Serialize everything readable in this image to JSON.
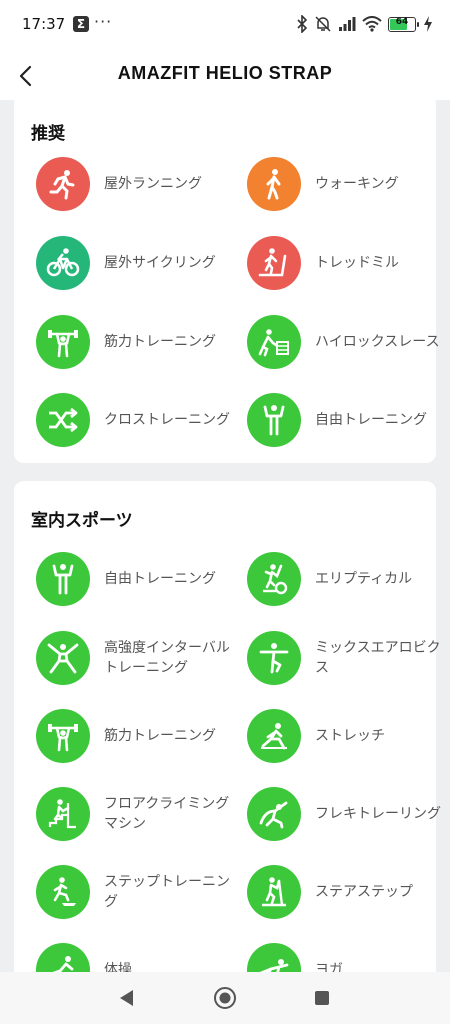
{
  "status_bar": {
    "time": "17:37",
    "notification_icon": "sigma-icon",
    "more": "···",
    "battery_level": "64",
    "icons": [
      "bluetooth-icon",
      "bell-off-icon",
      "signal-icon",
      "wifi-icon",
      "battery-icon",
      "charging-icon"
    ]
  },
  "header": {
    "title": "AMAZFIT HELIO STRAP",
    "back_icon": "back-chevron-icon"
  },
  "colors": {
    "red": "#ea5b53",
    "orange": "#f28130",
    "teal": "#25b77a",
    "green": "#3cc83a"
  },
  "sections": [
    {
      "title": "推奨",
      "items": [
        {
          "label": "屋外ランニング",
          "icon": "running-icon",
          "color": "#ea5b53"
        },
        {
          "label": "ウォーキング",
          "icon": "walking-icon",
          "color": "#f28130"
        },
        {
          "label": "屋外サイクリング",
          "icon": "cycling-icon",
          "color": "#25b77a"
        },
        {
          "label": "トレッドミル",
          "icon": "treadmill-icon",
          "color": "#ea5b53"
        },
        {
          "label": "筋力トレーニング",
          "icon": "weightlifting-icon",
          "color": "#3cc83a"
        },
        {
          "label": "ハイロックスレース",
          "icon": "hyrox-icon",
          "color": "#3cc83a"
        },
        {
          "label": "クロストレーニング",
          "icon": "shuffle-icon",
          "color": "#3cc83a"
        },
        {
          "label": "自由トレーニング",
          "icon": "free-training-icon",
          "color": "#3cc83a"
        }
      ]
    },
    {
      "title": "室内スポーツ",
      "items": [
        {
          "label": "自由トレーニング",
          "icon": "free-training-icon",
          "color": "#3cc83a"
        },
        {
          "label": "エリプティカル",
          "icon": "elliptical-icon",
          "color": "#3cc83a"
        },
        {
          "label": "高強度インターバルトレーニング",
          "icon": "hiit-icon",
          "color": "#3cc83a"
        },
        {
          "label": "ミックスエアロビクス",
          "icon": "aerobics-icon",
          "color": "#3cc83a"
        },
        {
          "label": "筋力トレーニング",
          "icon": "weightlifting-icon",
          "color": "#3cc83a"
        },
        {
          "label": "ストレッチ",
          "icon": "stretch-icon",
          "color": "#3cc83a"
        },
        {
          "label": "フロアクライミングマシン",
          "icon": "stair-climber-icon",
          "color": "#3cc83a"
        },
        {
          "label": "フレキトレーリング",
          "icon": "flexibility-icon",
          "color": "#3cc83a"
        },
        {
          "label": "ステップトレーニング",
          "icon": "step-training-icon",
          "color": "#3cc83a"
        },
        {
          "label": "ステアステップ",
          "icon": "stair-stepper-icon",
          "color": "#3cc83a"
        },
        {
          "label": "体操",
          "icon": "gymnastics-icon",
          "color": "#3cc83a"
        },
        {
          "label": "ヨガ",
          "icon": "yoga-icon",
          "color": "#3cc83a"
        }
      ]
    }
  ],
  "nav": {
    "back_icon": "nav-back-icon",
    "home_icon": "nav-home-icon",
    "recents_icon": "nav-recents-icon"
  }
}
